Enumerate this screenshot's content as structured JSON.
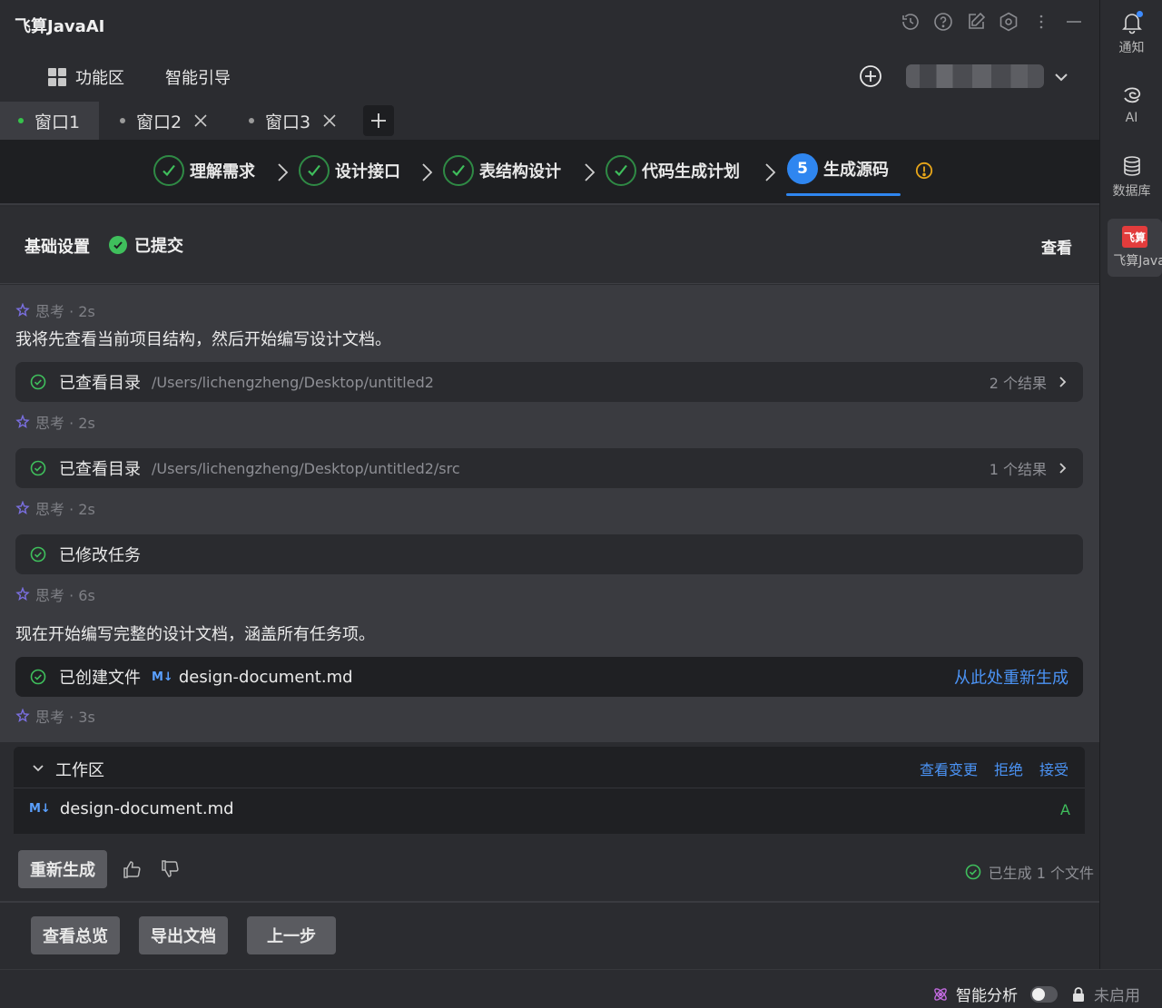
{
  "app": {
    "title": "飞算JavaAI"
  },
  "toolbar": {
    "functions_label": "功能区",
    "guide_label": "智能引导"
  },
  "tabs": [
    {
      "label": "窗口1",
      "active": true
    },
    {
      "label": "窗口2",
      "active": false
    },
    {
      "label": "窗口3",
      "active": false
    }
  ],
  "steps": [
    {
      "label": "理解需求",
      "done": true
    },
    {
      "label": "设计接口",
      "done": true
    },
    {
      "label": "表结构设计",
      "done": true
    },
    {
      "label": "代码生成计划",
      "done": true
    },
    {
      "label": "生成源码",
      "number": "5",
      "current": true
    }
  ],
  "basic": {
    "label": "基础设置",
    "status": "已提交",
    "view_label": "查看"
  },
  "chat": {
    "think1": "思考 · 2s",
    "msg1": "我将先查看当前项目结构，然后开始编写设计文档。",
    "card1": {
      "label": "已查看目录",
      "path": "/Users/lichengzheng/Desktop/untitled2",
      "result": "2 个结果"
    },
    "think2": "思考 · 2s",
    "card2": {
      "label": "已查看目录",
      "path": "/Users/lichengzheng/Desktop/untitled2/src",
      "result": "1 个结果"
    },
    "think3": "思考 · 2s",
    "card3": {
      "label": "已修改任务"
    },
    "think4": "思考 · 6s",
    "msg2": "现在开始编写完整的设计文档，涵盖所有任务项。",
    "card4": {
      "label": "已创建文件",
      "badge": "M↓",
      "file": "design-document.md",
      "action": "从此处重新生成"
    },
    "think5": "思考 · 3s"
  },
  "workspace": {
    "title": "工作区",
    "actions": {
      "view_changes": "查看变更",
      "reject": "拒绝",
      "accept": "接受"
    },
    "file": {
      "badge": "M↓",
      "name": "design-document.md",
      "flag": "A"
    }
  },
  "feedback": {
    "regenerate": "重新生成",
    "status": "已生成 1 个文件"
  },
  "footer": {
    "overview": "查看总览",
    "export": "导出文档",
    "prev": "上一步"
  },
  "statusbar": {
    "analysis_label": "智能分析",
    "disabled_label": "未启用"
  },
  "sidebar": {
    "notify": "通知",
    "ai": "AI",
    "db": "数据库",
    "feisuan_logo": "飞算",
    "feisuan": "飞算Java"
  },
  "colors": {
    "accent": "#2f86f0",
    "success": "#3fbf5c",
    "link": "#4b93f5",
    "warning": "#e8a61a",
    "logo": "#e23c3c"
  }
}
